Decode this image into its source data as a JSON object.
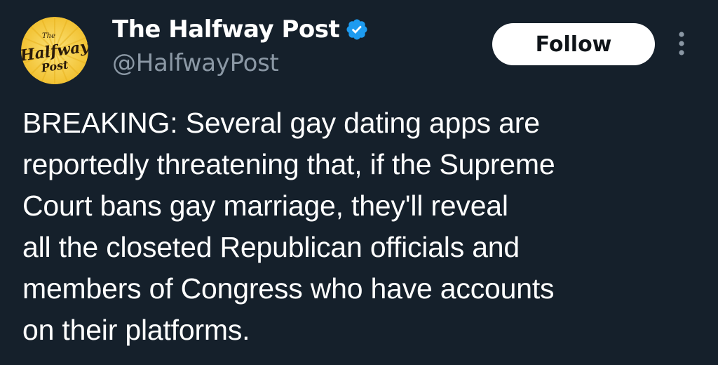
{
  "author": {
    "display_name": "The Halfway Post",
    "handle": "@HalfwayPost",
    "verified": true,
    "avatar_text_1": "The",
    "avatar_text_2": "Halfway",
    "avatar_text_3": "Post"
  },
  "actions": {
    "follow_label": "Follow",
    "more_icon": "more-vertical-icon"
  },
  "tweet": {
    "text": "BREAKING: Several gay dating apps are\nreportedly threatening that, if the Supreme\nCourt bans gay marriage, they'll reveal\nall the closeted Republican officials and\nmembers of Congress who have accounts\non their platforms."
  },
  "colors": {
    "background": "#15202b",
    "text": "#ffffff",
    "secondary_text": "#8b98a5",
    "verified_blue": "#1d9bf0",
    "avatar_yellow": "#f5d34a"
  }
}
